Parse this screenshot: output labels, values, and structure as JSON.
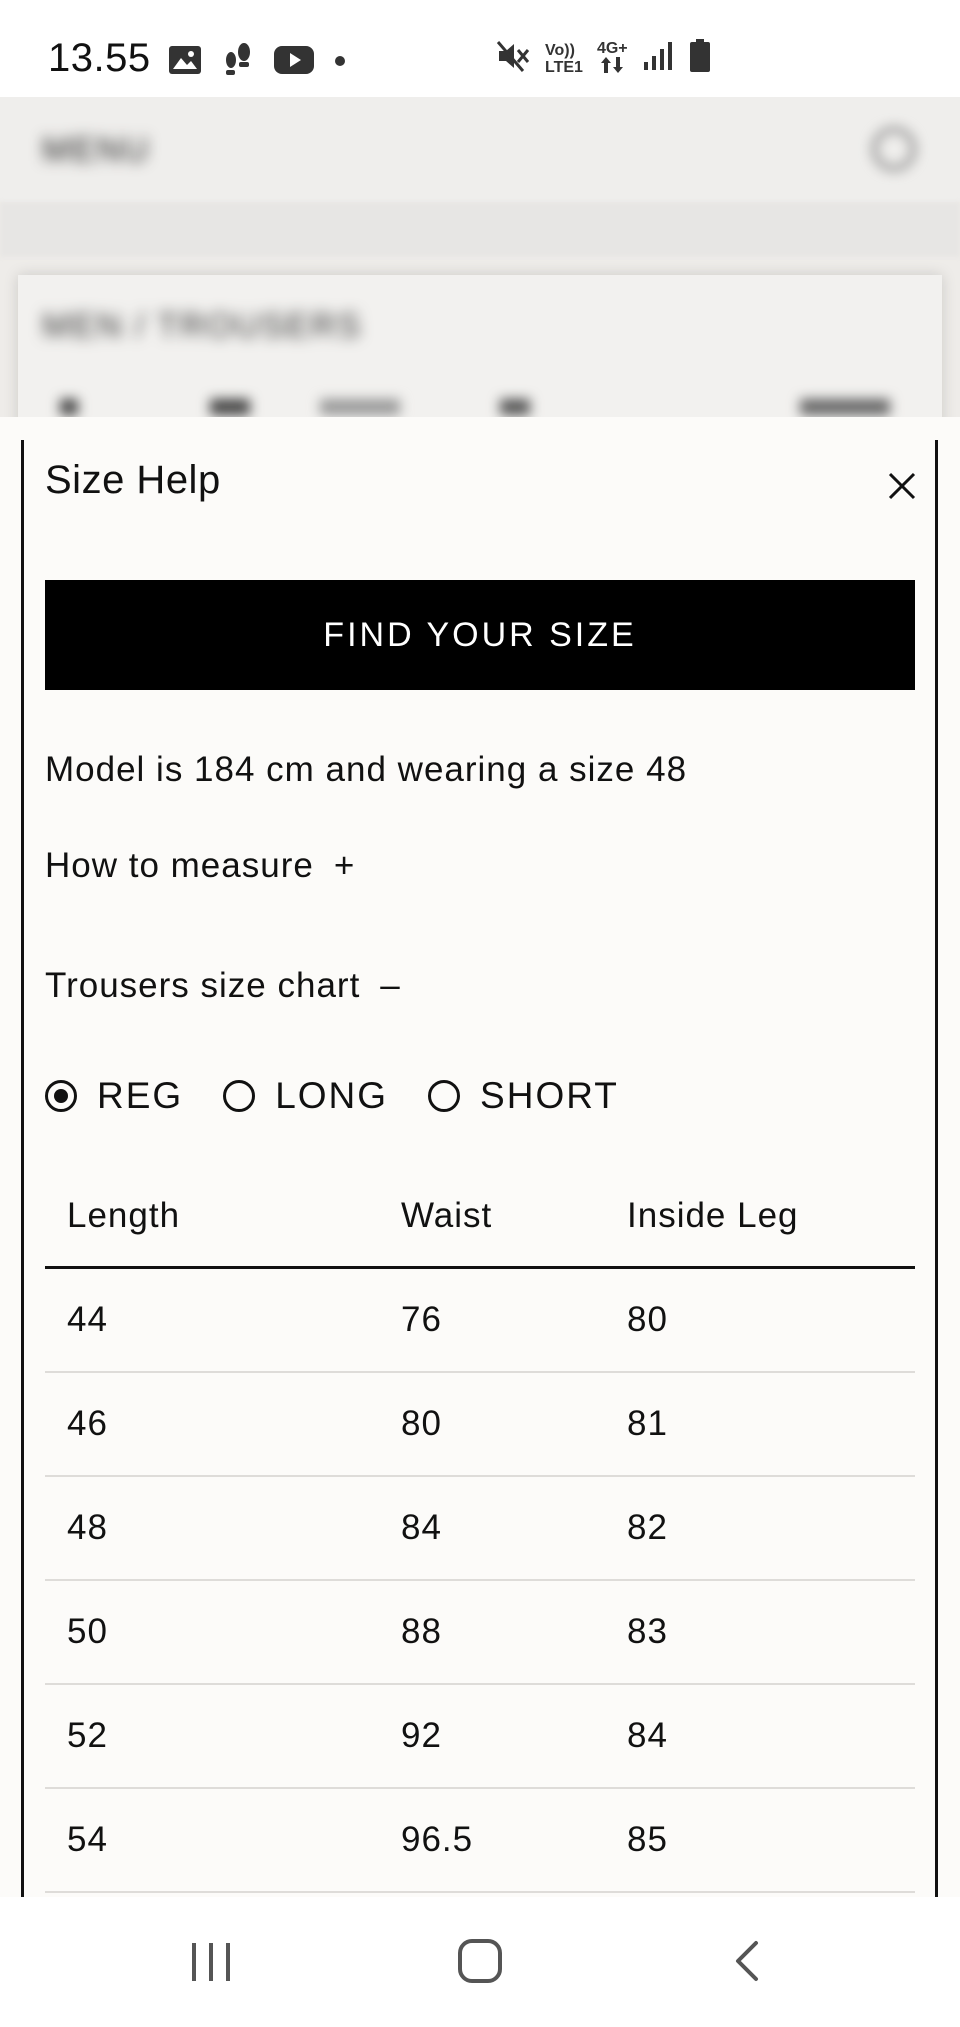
{
  "status_bar": {
    "time": "13.55",
    "left_icons": [
      "gallery-icon",
      "steps-icon",
      "youtube-icon",
      "dot-icon"
    ],
    "right_icons": [
      "mute-icon",
      "volte-icon",
      "network-4g-icon",
      "signal-icon",
      "battery-icon"
    ],
    "volte_top": "Vo))",
    "volte_bottom": "LTE1",
    "network_label": "4G+"
  },
  "background_page": {
    "menu_label": "MENU",
    "breadcrumb": "MEN / TROUSERS"
  },
  "sheet": {
    "title": "Size Help",
    "close_icon": "close-icon",
    "find_size_button": "FIND YOUR SIZE",
    "model_info": "Model is 184 cm and wearing a size 48",
    "how_to_measure": {
      "label": "How to measure",
      "toggle": "+"
    },
    "size_chart": {
      "label": "Trousers size chart",
      "toggle": "–"
    },
    "fit_options": [
      {
        "label": "REG",
        "selected": true
      },
      {
        "label": "LONG",
        "selected": false
      },
      {
        "label": "SHORT",
        "selected": false
      }
    ],
    "table": {
      "headers": [
        "Length",
        "Waist",
        "Inside Leg"
      ],
      "rows": [
        [
          "44",
          "76",
          "80"
        ],
        [
          "46",
          "80",
          "81"
        ],
        [
          "48",
          "84",
          "82"
        ],
        [
          "50",
          "88",
          "83"
        ],
        [
          "52",
          "92",
          "84"
        ],
        [
          "54",
          "96.5",
          "85"
        ]
      ]
    }
  },
  "nav_bar": {
    "buttons": [
      "recents-icon",
      "home-icon",
      "back-icon"
    ]
  }
}
